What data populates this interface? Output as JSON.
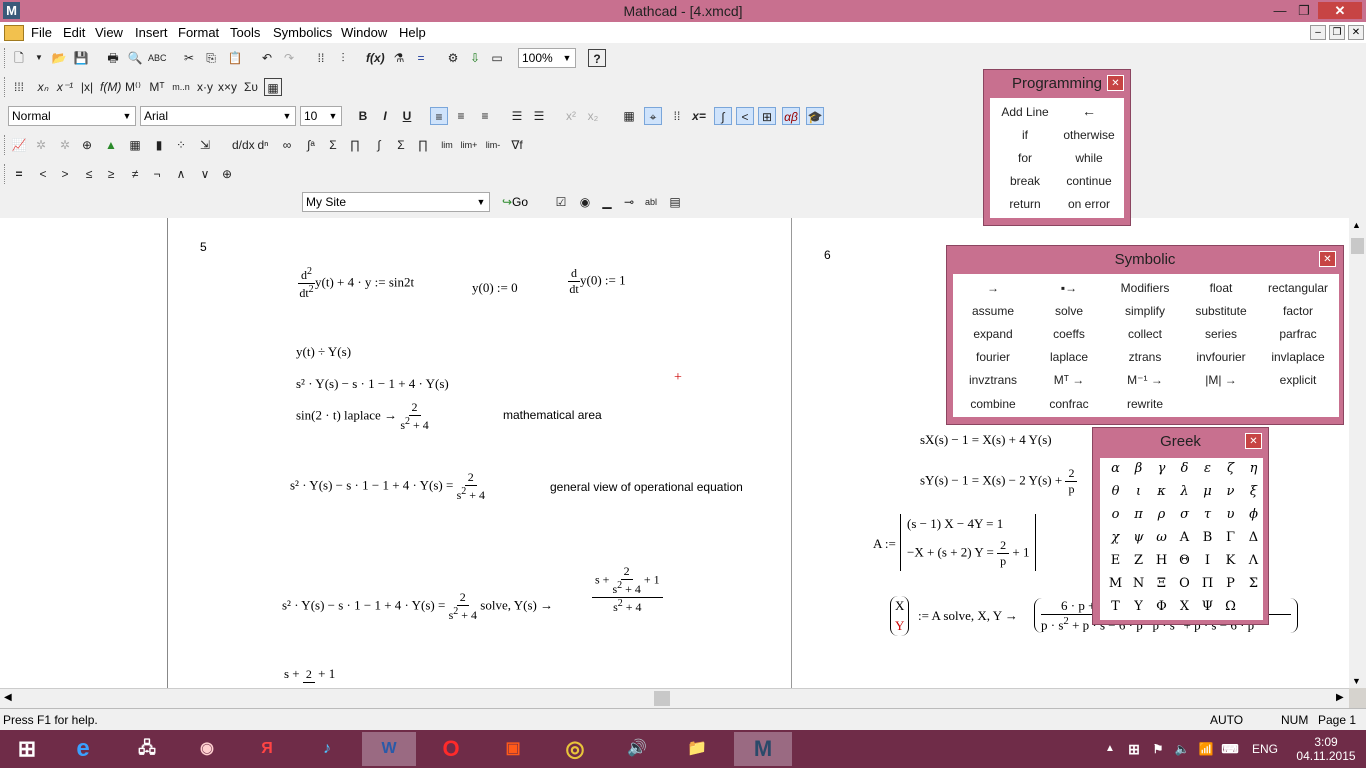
{
  "window": {
    "title": "Mathcad - [4.xmcd]"
  },
  "menu": [
    "File",
    "Edit",
    "View",
    "Insert",
    "Format",
    "Tools",
    "Symbolics",
    "Window",
    "Help"
  ],
  "toolbar": {
    "zoom": "100%",
    "style": "Normal",
    "font": "Arial",
    "size": "10",
    "site": "My Site",
    "go": "Go"
  },
  "mathbar": [
    "=",
    "<",
    ">",
    "≤",
    "≥",
    "≠",
    "¬",
    "∧",
    "∨",
    "⊕"
  ],
  "doc": {
    "page_left": "5",
    "page_right": "6",
    "label_area": "mathematical area",
    "label_general": "general view of operational equation",
    "ode": "y(t) + 4 · y := sin2t",
    "ic1": "y(0) := 0",
    "ic2": "y(0) := 1",
    "transform": "y(t) ÷ Y(s)",
    "lap": "s² · Y(s) − s · 1 − 1 + 4 · Y(s)",
    "sinlap": "sin(2 · t) laplace →",
    "eq2": "s² · Y(s) − s · 1 − 1 + 4 · Y(s) =",
    "solve": "solve, Y(s) →",
    "sys1": "sX(s) − 1 = X(s) + 4 Y(s)",
    "sys2": "sY(s) − 1 = X(s) − 2 Y(s) +",
    "A": "A :=",
    "row1": "(s − 1) X − 4Y = 1",
    "row2": "−X + (s + 2) Y =",
    "solveXY": ":= A solve, X, Y →"
  },
  "palettes": {
    "programming": {
      "title": "Programming",
      "items": [
        "Add Line",
        "←",
        "if",
        "otherwise",
        "for",
        "while",
        "break",
        "continue",
        "return",
        "on error"
      ]
    },
    "symbolic": {
      "title": "Symbolic",
      "items": [
        "→",
        "▪→",
        "Modifiers",
        "float",
        "rectangular",
        "assume",
        "solve",
        "simplify",
        "substitute",
        "factor",
        "expand",
        "coeffs",
        "collect",
        "series",
        "parfrac",
        "fourier",
        "laplace",
        "ztrans",
        "invfourier",
        "invlaplace",
        "invztrans",
        "Mᵀ →",
        "M⁻¹ →",
        "|M| →",
        "explicit",
        "combine",
        "confrac",
        "rewrite"
      ]
    },
    "greek": {
      "title": "Greek",
      "items": [
        "α",
        "β",
        "γ",
        "δ",
        "ε",
        "ζ",
        "η",
        "θ",
        "ι",
        "κ",
        "λ",
        "μ",
        "ν",
        "ξ",
        "ο",
        "π",
        "ρ",
        "σ",
        "τ",
        "υ",
        "ϕ",
        "χ",
        "ψ",
        "ω",
        "Α",
        "Β",
        "Γ",
        "Δ",
        "Ε",
        "Ζ",
        "Η",
        "Θ",
        "Ι",
        "Κ",
        "Λ",
        "Μ",
        "Ν",
        "Ξ",
        "Ο",
        "Π",
        "Ρ",
        "Σ",
        "Τ",
        "Υ",
        "Φ",
        "Χ",
        "Ψ",
        "Ω"
      ]
    }
  },
  "status": {
    "help": "Press F1 for help.",
    "mode": "AUTO",
    "num": "NUM",
    "page": "Page 1"
  },
  "taskbar": {
    "lang": "ENG",
    "time": "3:09",
    "date": "04.11.2015"
  }
}
